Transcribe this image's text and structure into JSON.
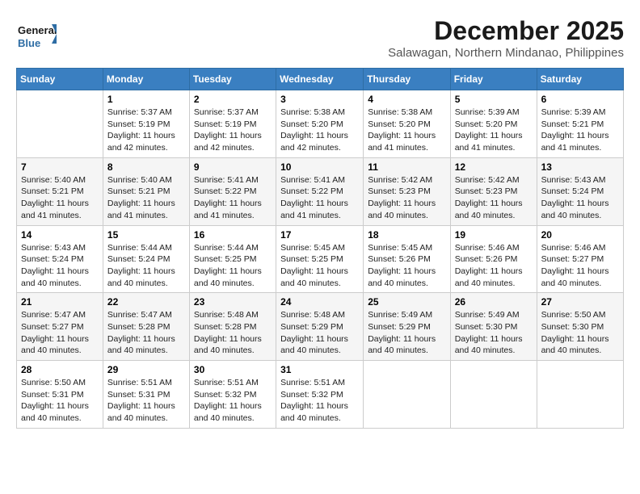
{
  "logo": {
    "general": "General",
    "blue": "Blue"
  },
  "title": {
    "month_year": "December 2025",
    "location": "Salawagan, Northern Mindanao, Philippines"
  },
  "calendar": {
    "headers": [
      "Sunday",
      "Monday",
      "Tuesday",
      "Wednesday",
      "Thursday",
      "Friday",
      "Saturday"
    ],
    "rows": [
      [
        {
          "day": "",
          "sunrise": "",
          "sunset": "",
          "daylight": ""
        },
        {
          "day": "1",
          "sunrise": "Sunrise: 5:37 AM",
          "sunset": "Sunset: 5:19 PM",
          "daylight": "Daylight: 11 hours and 42 minutes."
        },
        {
          "day": "2",
          "sunrise": "Sunrise: 5:37 AM",
          "sunset": "Sunset: 5:19 PM",
          "daylight": "Daylight: 11 hours and 42 minutes."
        },
        {
          "day": "3",
          "sunrise": "Sunrise: 5:38 AM",
          "sunset": "Sunset: 5:20 PM",
          "daylight": "Daylight: 11 hours and 42 minutes."
        },
        {
          "day": "4",
          "sunrise": "Sunrise: 5:38 AM",
          "sunset": "Sunset: 5:20 PM",
          "daylight": "Daylight: 11 hours and 41 minutes."
        },
        {
          "day": "5",
          "sunrise": "Sunrise: 5:39 AM",
          "sunset": "Sunset: 5:20 PM",
          "daylight": "Daylight: 11 hours and 41 minutes."
        },
        {
          "day": "6",
          "sunrise": "Sunrise: 5:39 AM",
          "sunset": "Sunset: 5:21 PM",
          "daylight": "Daylight: 11 hours and 41 minutes."
        }
      ],
      [
        {
          "day": "7",
          "sunrise": "Sunrise: 5:40 AM",
          "sunset": "Sunset: 5:21 PM",
          "daylight": "Daylight: 11 hours and 41 minutes."
        },
        {
          "day": "8",
          "sunrise": "Sunrise: 5:40 AM",
          "sunset": "Sunset: 5:21 PM",
          "daylight": "Daylight: 11 hours and 41 minutes."
        },
        {
          "day": "9",
          "sunrise": "Sunrise: 5:41 AM",
          "sunset": "Sunset: 5:22 PM",
          "daylight": "Daylight: 11 hours and 41 minutes."
        },
        {
          "day": "10",
          "sunrise": "Sunrise: 5:41 AM",
          "sunset": "Sunset: 5:22 PM",
          "daylight": "Daylight: 11 hours and 41 minutes."
        },
        {
          "day": "11",
          "sunrise": "Sunrise: 5:42 AM",
          "sunset": "Sunset: 5:23 PM",
          "daylight": "Daylight: 11 hours and 40 minutes."
        },
        {
          "day": "12",
          "sunrise": "Sunrise: 5:42 AM",
          "sunset": "Sunset: 5:23 PM",
          "daylight": "Daylight: 11 hours and 40 minutes."
        },
        {
          "day": "13",
          "sunrise": "Sunrise: 5:43 AM",
          "sunset": "Sunset: 5:24 PM",
          "daylight": "Daylight: 11 hours and 40 minutes."
        }
      ],
      [
        {
          "day": "14",
          "sunrise": "Sunrise: 5:43 AM",
          "sunset": "Sunset: 5:24 PM",
          "daylight": "Daylight: 11 hours and 40 minutes."
        },
        {
          "day": "15",
          "sunrise": "Sunrise: 5:44 AM",
          "sunset": "Sunset: 5:24 PM",
          "daylight": "Daylight: 11 hours and 40 minutes."
        },
        {
          "day": "16",
          "sunrise": "Sunrise: 5:44 AM",
          "sunset": "Sunset: 5:25 PM",
          "daylight": "Daylight: 11 hours and 40 minutes."
        },
        {
          "day": "17",
          "sunrise": "Sunrise: 5:45 AM",
          "sunset": "Sunset: 5:25 PM",
          "daylight": "Daylight: 11 hours and 40 minutes."
        },
        {
          "day": "18",
          "sunrise": "Sunrise: 5:45 AM",
          "sunset": "Sunset: 5:26 PM",
          "daylight": "Daylight: 11 hours and 40 minutes."
        },
        {
          "day": "19",
          "sunrise": "Sunrise: 5:46 AM",
          "sunset": "Sunset: 5:26 PM",
          "daylight": "Daylight: 11 hours and 40 minutes."
        },
        {
          "day": "20",
          "sunrise": "Sunrise: 5:46 AM",
          "sunset": "Sunset: 5:27 PM",
          "daylight": "Daylight: 11 hours and 40 minutes."
        }
      ],
      [
        {
          "day": "21",
          "sunrise": "Sunrise: 5:47 AM",
          "sunset": "Sunset: 5:27 PM",
          "daylight": "Daylight: 11 hours and 40 minutes."
        },
        {
          "day": "22",
          "sunrise": "Sunrise: 5:47 AM",
          "sunset": "Sunset: 5:28 PM",
          "daylight": "Daylight: 11 hours and 40 minutes."
        },
        {
          "day": "23",
          "sunrise": "Sunrise: 5:48 AM",
          "sunset": "Sunset: 5:28 PM",
          "daylight": "Daylight: 11 hours and 40 minutes."
        },
        {
          "day": "24",
          "sunrise": "Sunrise: 5:48 AM",
          "sunset": "Sunset: 5:29 PM",
          "daylight": "Daylight: 11 hours and 40 minutes."
        },
        {
          "day": "25",
          "sunrise": "Sunrise: 5:49 AM",
          "sunset": "Sunset: 5:29 PM",
          "daylight": "Daylight: 11 hours and 40 minutes."
        },
        {
          "day": "26",
          "sunrise": "Sunrise: 5:49 AM",
          "sunset": "Sunset: 5:30 PM",
          "daylight": "Daylight: 11 hours and 40 minutes."
        },
        {
          "day": "27",
          "sunrise": "Sunrise: 5:50 AM",
          "sunset": "Sunset: 5:30 PM",
          "daylight": "Daylight: 11 hours and 40 minutes."
        }
      ],
      [
        {
          "day": "28",
          "sunrise": "Sunrise: 5:50 AM",
          "sunset": "Sunset: 5:31 PM",
          "daylight": "Daylight: 11 hours and 40 minutes."
        },
        {
          "day": "29",
          "sunrise": "Sunrise: 5:51 AM",
          "sunset": "Sunset: 5:31 PM",
          "daylight": "Daylight: 11 hours and 40 minutes."
        },
        {
          "day": "30",
          "sunrise": "Sunrise: 5:51 AM",
          "sunset": "Sunset: 5:32 PM",
          "daylight": "Daylight: 11 hours and 40 minutes."
        },
        {
          "day": "31",
          "sunrise": "Sunrise: 5:51 AM",
          "sunset": "Sunset: 5:32 PM",
          "daylight": "Daylight: 11 hours and 40 minutes."
        },
        {
          "day": "",
          "sunrise": "",
          "sunset": "",
          "daylight": ""
        },
        {
          "day": "",
          "sunrise": "",
          "sunset": "",
          "daylight": ""
        },
        {
          "day": "",
          "sunrise": "",
          "sunset": "",
          "daylight": ""
        }
      ]
    ]
  }
}
